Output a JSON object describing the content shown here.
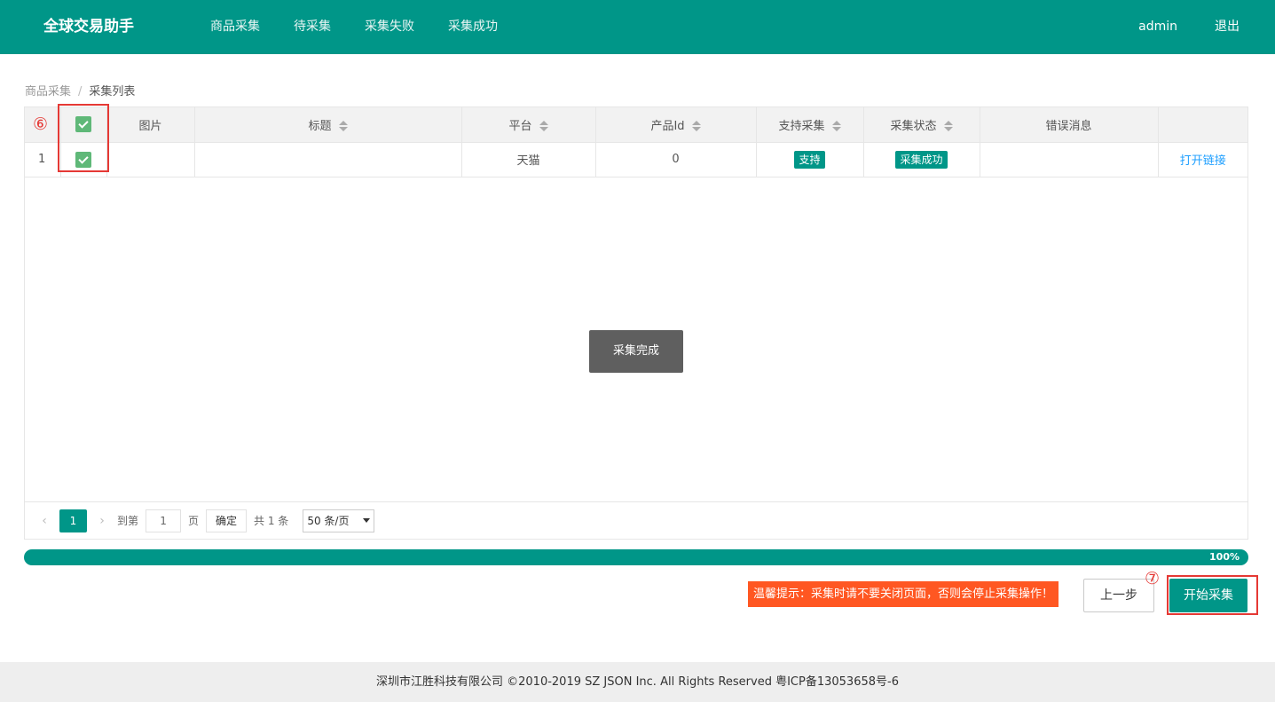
{
  "header": {
    "brand": "全球交易助手",
    "nav": [
      "商品采集",
      "待采集",
      "采集失败",
      "采集成功"
    ],
    "user": "admin",
    "logout": "退出"
  },
  "breadcrumb": {
    "parent": "商品采集",
    "separator": "/",
    "current": "采集列表"
  },
  "table": {
    "columns": [
      "图片",
      "标题",
      "平台",
      "产品Id",
      "支持采集",
      "采集状态",
      "错误消息",
      ""
    ],
    "rows": [
      {
        "index": "1",
        "image": "",
        "title": "",
        "platform": "天猫",
        "product_id": "0",
        "support": "支持",
        "status": "采集成功",
        "error": "",
        "action": "打开链接"
      }
    ]
  },
  "annotations": {
    "step6": "⑥",
    "step7": "⑦"
  },
  "toast": "采集完成",
  "pager": {
    "prev": "‹",
    "current": "1",
    "next": "›",
    "goto_label": "到第",
    "goto_value": "1",
    "page_label": "页",
    "confirm": "确定",
    "total": "共 1 条",
    "page_size": "50 条/页"
  },
  "progress": {
    "label": "100%",
    "value": 100
  },
  "warning": "温馨提示：采集时请不要关闭页面，否则会停止采集操作！",
  "buttons": {
    "prev_step": "上一步",
    "start": "开始采集"
  },
  "footer": "深圳市江胜科技有限公司 ©2010-2019 SZ JSON Inc. All Rights Reserved 粤ICP备13053658号-6",
  "colors": {
    "primary": "#009688",
    "checkbox": "#5fb878",
    "warning": "#ff5722",
    "annotation": "#e53935",
    "link": "#1e9fff"
  }
}
